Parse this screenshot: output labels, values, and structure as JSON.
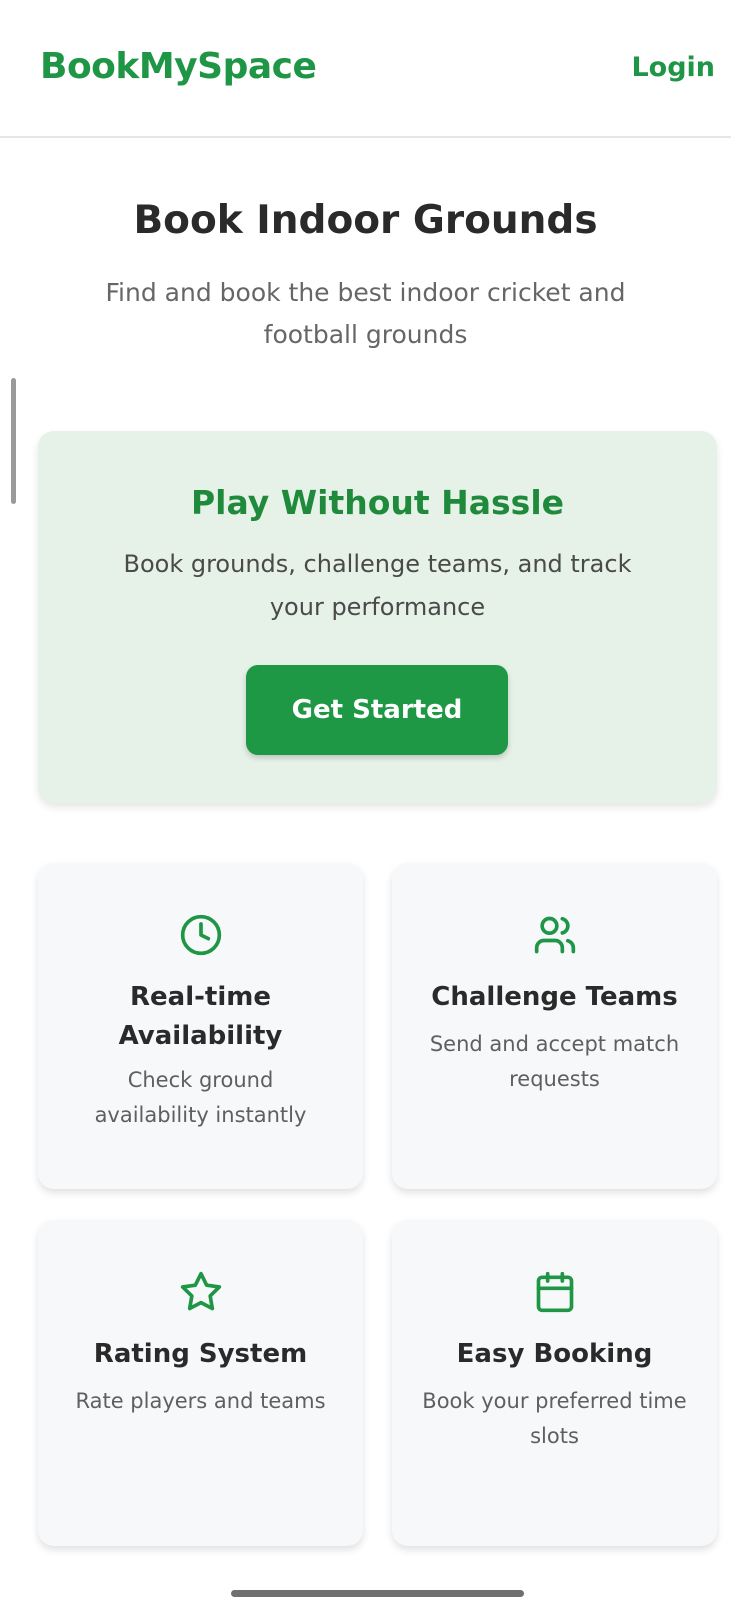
{
  "header": {
    "brand": "BookMySpace",
    "login_label": "Login"
  },
  "hero": {
    "title": "Book Indoor Grounds",
    "subtitle": "Find and book the best indoor cricket and football grounds"
  },
  "promo": {
    "title": "Play Without Hassle",
    "text": "Book grounds, challenge teams, and track your performance",
    "cta_label": "Get Started"
  },
  "features": [
    {
      "icon": "clock-icon",
      "title": "Real-time Availability",
      "desc": "Check ground availability instantly"
    },
    {
      "icon": "users-icon",
      "title": "Challenge Teams",
      "desc": "Send and accept match requests"
    },
    {
      "icon": "star-icon",
      "title": "Rating System",
      "desc": "Rate players and teams"
    },
    {
      "icon": "calendar-icon",
      "title": "Easy Booking",
      "desc": "Book your preferred time slots"
    }
  ],
  "colors": {
    "brand_green": "#1e9645",
    "promo_bg": "#e6f2e8",
    "card_bg": "#f6f8fa"
  }
}
